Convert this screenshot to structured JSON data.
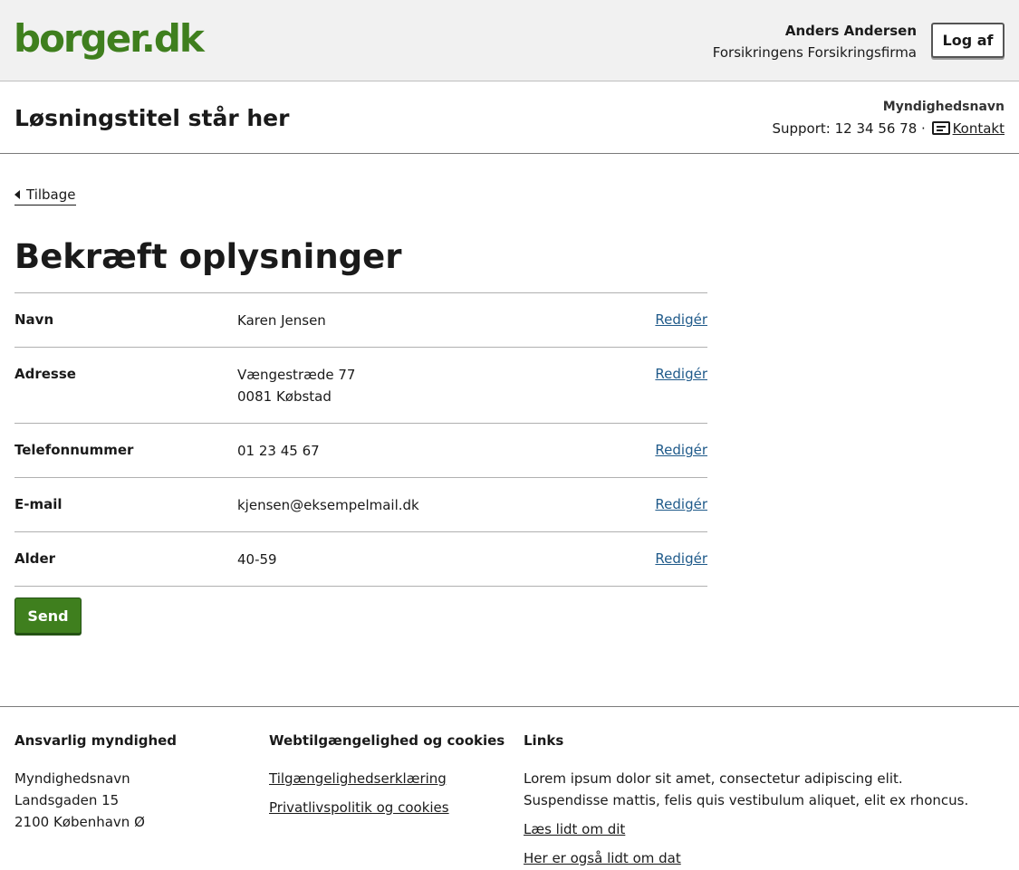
{
  "portal": {
    "logo": "borger.dk",
    "user_name": "Anders Andersen",
    "user_org": "Forsikringens Forsikringsfirma",
    "logout_label": "Log af"
  },
  "solution": {
    "title": "Løsningstitel står her",
    "authority": "Myndighedsnavn",
    "support_text": "Support: 12 34 56 78 ·",
    "contact_label": "Kontakt",
    "contact_icon": "message-icon"
  },
  "back_label": "Tilbage",
  "page_title": "Bekræft oplysninger",
  "summary": [
    {
      "key": "Navn",
      "value_lines": [
        "Karen Jensen"
      ],
      "action": "Redigér"
    },
    {
      "key": "Adresse",
      "value_lines": [
        "Vængestræde 77",
        "0081 Købstad"
      ],
      "action": "Redigér"
    },
    {
      "key": "Telefonnummer",
      "value_lines": [
        "01 23 45 67"
      ],
      "action": "Redigér"
    },
    {
      "key": "E-mail",
      "value_lines": [
        "kjensen@eksempelmail.dk"
      ],
      "action": "Redigér"
    },
    {
      "key": "Alder",
      "value_lines": [
        "40-59"
      ],
      "action": "Redigér"
    }
  ],
  "send_label": "Send",
  "footer": {
    "col1_title": "Ansvarlig myndighed",
    "col1_lines": [
      "Myndighedsnavn",
      "Landsgaden 15",
      "2100 København Ø"
    ],
    "col2_title": "Webtilgængelighed og cookies",
    "col2_links": [
      "Tilgængelighedserklæring",
      "Privatlivspolitik og cookies"
    ],
    "col3_title": "Links",
    "col3_text": "Lorem ipsum dolor sit amet, consectetur adipiscing elit. Suspendisse mattis, felis quis vestibulum aliquet, elit ex rhoncus.",
    "col3_links": [
      "Læs lidt om dit",
      "Her er også lidt om dat"
    ]
  },
  "colors": {
    "brand_green": "#3f7f1e",
    "link_blue": "#1f5a8a",
    "header_bg": "#f1f1f1"
  }
}
